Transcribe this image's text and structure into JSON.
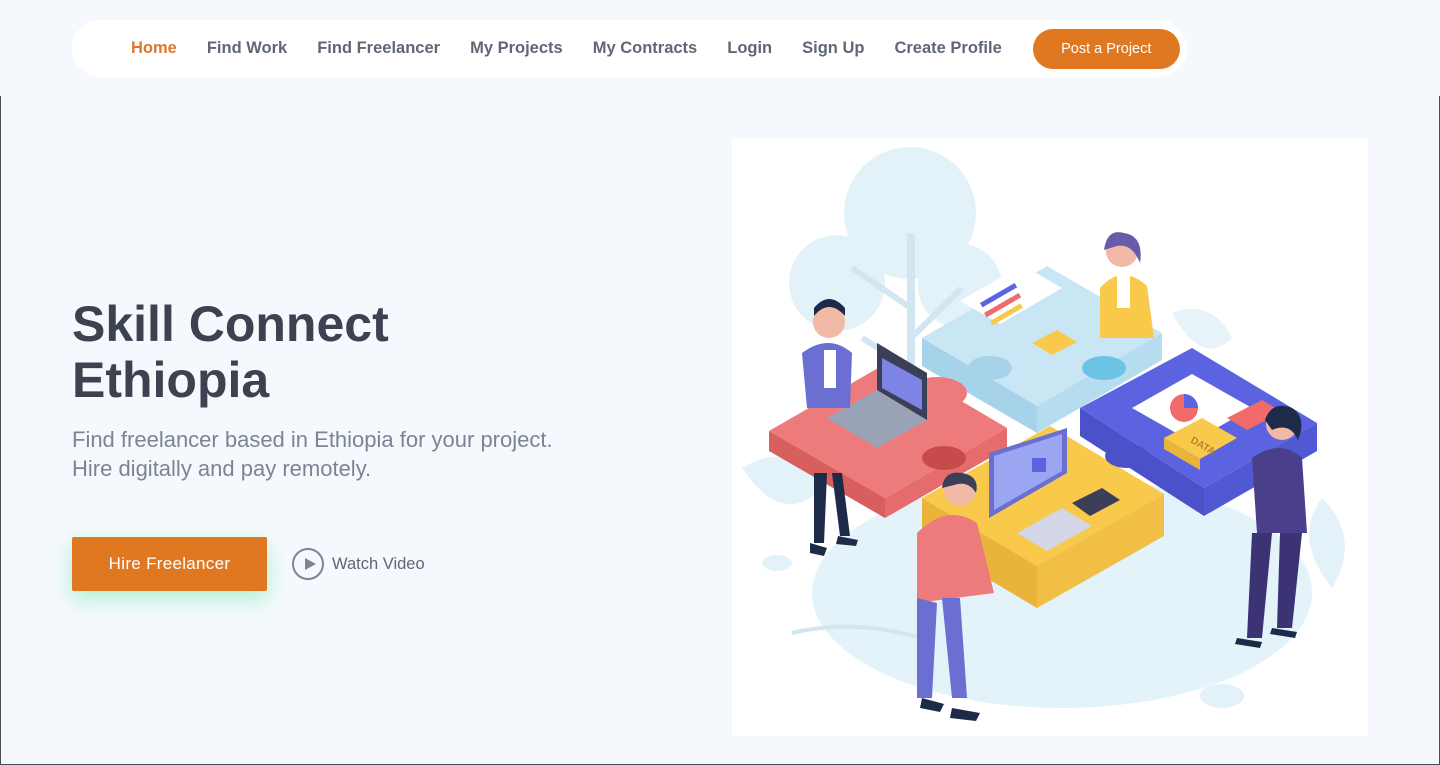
{
  "nav": {
    "items": [
      {
        "label": "Home",
        "active": true
      },
      {
        "label": "Find Work"
      },
      {
        "label": "Find Freelancer"
      },
      {
        "label": "My Projects"
      },
      {
        "label": "My Contracts"
      },
      {
        "label": "Login"
      },
      {
        "label": "Sign Up"
      },
      {
        "label": "Create Profile"
      }
    ],
    "post_button": "Post a Project"
  },
  "hero": {
    "title_line1": "Skill Connect",
    "title_line2": "Ethiopia",
    "subtitle_line1": "Find freelancer based in Ethiopia for your project.",
    "subtitle_line2": "Hire digitally and pay remotely.",
    "hire_button": "Hire Freelancer",
    "watch_label": "Watch Video"
  },
  "illustration": {
    "icon": "puzzle-teamwork-illustration",
    "data_tag": "DATA"
  },
  "colors": {
    "accent": "#e07822",
    "text_dark": "#3c4250",
    "text_muted": "#7b8494",
    "background": "#f5f9fe"
  }
}
